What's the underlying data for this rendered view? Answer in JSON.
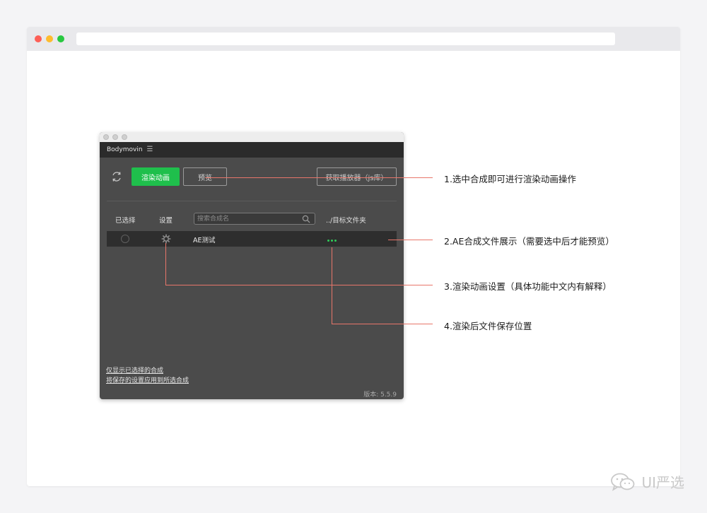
{
  "panel": {
    "title": "Bodymovin",
    "render_button": "渲染动画",
    "preview_button": "预览",
    "player_button": "获取播放器（js库）",
    "columns": {
      "selected": "已选择",
      "settings": "设置",
      "destination": "../目标文件夹"
    },
    "search": {
      "placeholder": "搜索合成名"
    },
    "compositions": [
      {
        "name": "AE测试"
      }
    ],
    "links": {
      "show_selected": "仅显示已选择的合成",
      "apply_settings": "将保存的设置应用到所选合成"
    },
    "version": "版本: 5.5.9"
  },
  "annotations": [
    "1.选中合成即可进行渲染动画操作",
    "2.AE合成文件展示（需要选中后才能预览）",
    "3.渲染动画设置（具体功能中文内有解释）",
    "4.渲染后文件保存位置"
  ],
  "watermark": {
    "text": "UI严选",
    "icon": "wechat-icon"
  },
  "colors": {
    "accent_green": "#1fbf4c",
    "callout_red": "#e8766a",
    "panel_bg": "#4b4b4b"
  }
}
